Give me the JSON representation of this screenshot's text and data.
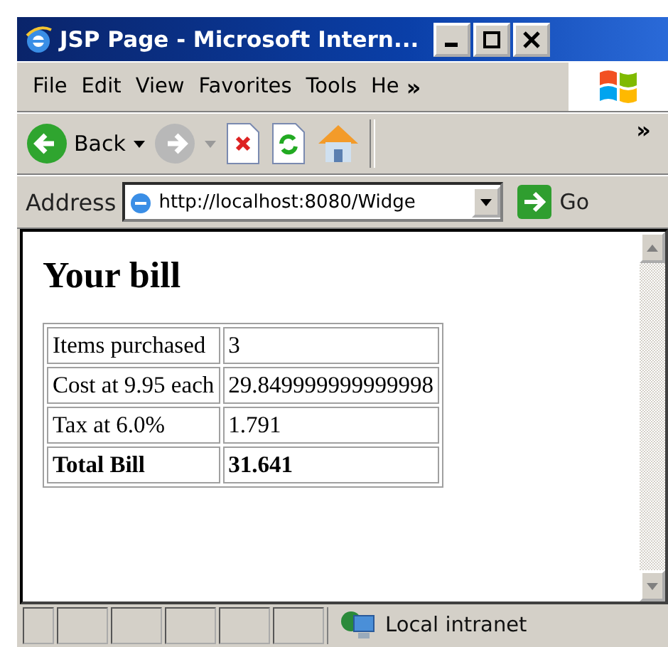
{
  "window": {
    "title": "JSP Page - Microsoft Intern..."
  },
  "menu": [
    {
      "label": "File"
    },
    {
      "label": "Edit"
    },
    {
      "label": "View"
    },
    {
      "label": "Favorites"
    },
    {
      "label": "Tools"
    },
    {
      "label": "He"
    }
  ],
  "menu_overflow": "»",
  "toolbar": {
    "back_label": "Back",
    "overflow": "»"
  },
  "address_bar": {
    "label": "Address",
    "value": "http://localhost:8080/Widge",
    "go_label": "Go"
  },
  "page": {
    "heading": "Your bill",
    "rows": [
      {
        "label": "Items purchased",
        "value": "3",
        "bold": false
      },
      {
        "label": "Cost at 9.95 each",
        "value": "29.849999999999998",
        "bold": false
      },
      {
        "label": "Tax at 6.0%",
        "value": "1.791",
        "bold": false
      },
      {
        "label": "Total Bill",
        "value": "31.641",
        "bold": true
      }
    ]
  },
  "status_bar": {
    "zone": "Local intranet"
  }
}
